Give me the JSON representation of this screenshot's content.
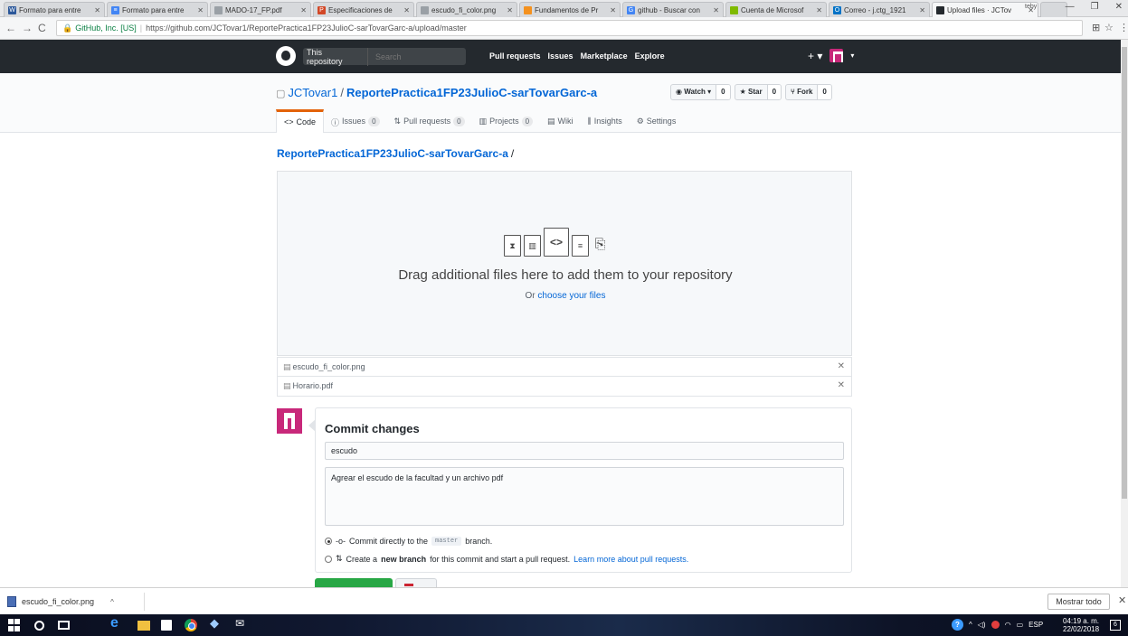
{
  "browser": {
    "tabs": [
      {
        "title": "Formato para entre",
        "color": "#2b579a",
        "glyph": "W"
      },
      {
        "title": "Formato para entre",
        "color": "#4285f4",
        "glyph": "≡"
      },
      {
        "title": "MADO-17_FP.pdf",
        "color": "#9aa0a6",
        "glyph": ""
      },
      {
        "title": "Especificaciones de",
        "color": "#d24726",
        "glyph": "P"
      },
      {
        "title": "escudo_fi_color.png",
        "color": "#9aa0a6",
        "glyph": ""
      },
      {
        "title": "Fundamentos de Pr",
        "color": "#f4911e",
        "glyph": ""
      },
      {
        "title": "github - Buscar con",
        "color": "#4285f4",
        "glyph": "G"
      },
      {
        "title": "Cuenta de Microsof",
        "color": "#7fba00",
        "glyph": ""
      },
      {
        "title": "Correo - j.ctg_1921",
        "color": "#0072c6",
        "glyph": "O"
      },
      {
        "title": "Upload files · JCTov",
        "color": "#24292e",
        "glyph": ""
      }
    ],
    "window_label": "teby",
    "site_label": "GitHub, Inc. [US]",
    "url": "https://github.com/JCTovar1/ReportePractica1FP23JulioC-sarTovarGarc-a/upload/master"
  },
  "github": {
    "scope_label": "This repository",
    "search_placeholder": "Search",
    "nav": [
      "Pull requests",
      "Issues",
      "Marketplace",
      "Explore"
    ],
    "plus_label": "+ ▾"
  },
  "repo": {
    "owner": "JCTovar1",
    "name": "ReportePractica1FP23JulioC-sarTovarGarc-a",
    "watch_label": "Watch ▾",
    "watch_count": "0",
    "star_label": "Star",
    "star_count": "0",
    "fork_label": "Fork",
    "fork_count": "0",
    "tabs": {
      "code": "Code",
      "issues": "Issues",
      "issues_count": "0",
      "pulls": "Pull requests",
      "pulls_count": "0",
      "projects": "Projects",
      "projects_count": "0",
      "wiki": "Wiki",
      "insights": "Insights",
      "settings": "Settings"
    }
  },
  "upload": {
    "breadcrumb": "ReportePractica1FP23JulioC-sarTovarGarc-a",
    "breadcrumb_sep": "/",
    "drop_text": "Drag additional files here to add them to your repository",
    "or_text": "Or",
    "choose_link": "choose your files",
    "files": [
      "escudo_fi_color.png",
      "Horario.pdf"
    ]
  },
  "commit": {
    "heading": "Commit changes",
    "title_value": "escudo",
    "description_value": "Agrear el escudo de la facultad y un archivo pdf",
    "option1_prefix": "Commit directly to the",
    "option1_branch": "master",
    "option1_suffix": "branch.",
    "option2_prefix": "Create a",
    "option2_bold": "new branch",
    "option2_suffix": "for this commit and start a pull request.",
    "option2_link": "Learn more about pull requests."
  },
  "downloads": {
    "file": "escudo_fi_color.png",
    "show_all": "Mostrar todo"
  },
  "taskbar": {
    "lang": "ESP",
    "time": "04:19 a. m.",
    "date": "22/02/2018",
    "notif_count": "6"
  }
}
